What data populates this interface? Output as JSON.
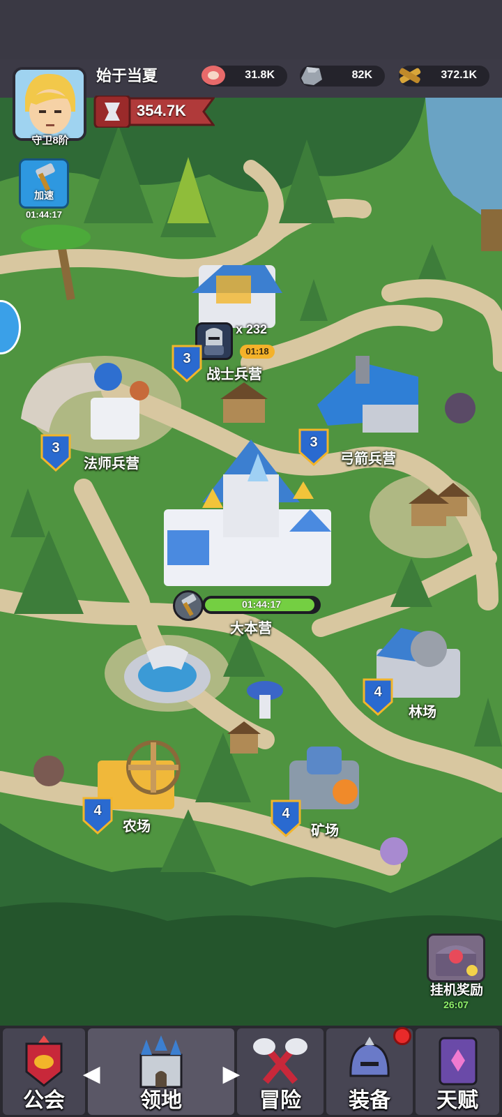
{
  "player": {
    "name": "始于当夏",
    "rank": "守卫8阶",
    "power": "354.7K"
  },
  "resources": [
    {
      "icon": "meat-icon",
      "value": "31.8K"
    },
    {
      "icon": "stone-icon",
      "value": "82K"
    },
    {
      "icon": "wood-icon",
      "value": "372.1K"
    }
  ],
  "speedup": {
    "label": "加速",
    "timer": "01:44:17"
  },
  "buildings": {
    "warrior": {
      "name": "战士兵营",
      "level": "3",
      "troops": "x 232",
      "train_time": "01:18"
    },
    "mage": {
      "name": "法师兵营",
      "level": "3"
    },
    "archer": {
      "name": "弓箭兵营",
      "level": "3"
    },
    "hq": {
      "name": "大本营",
      "timer": "01:44:17",
      "progress": 0.97
    },
    "lumber": {
      "name": "林场",
      "level": "4"
    },
    "farm": {
      "name": "农场",
      "level": "4"
    },
    "mine": {
      "name": "矿场",
      "level": "4"
    }
  },
  "idle_reward": {
    "label": "挂机奖励",
    "timer": "26:07"
  },
  "nav": {
    "tabs": [
      {
        "label": "公会",
        "icon": "guild-banner-icon"
      },
      {
        "label": "领地",
        "icon": "castle-icon"
      },
      {
        "label": "冒险",
        "icon": "crossed-axes-icon"
      },
      {
        "label": "装备",
        "icon": "helmet-icon"
      },
      {
        "label": "天赋",
        "icon": "spellbook-icon"
      }
    ],
    "active": "领地"
  },
  "colors": {
    "grass": "#4f9440",
    "path": "#d8c7a0",
    "forest": "#2f6a36",
    "water": "#6aa3c4",
    "accent": "#2e98e0"
  }
}
